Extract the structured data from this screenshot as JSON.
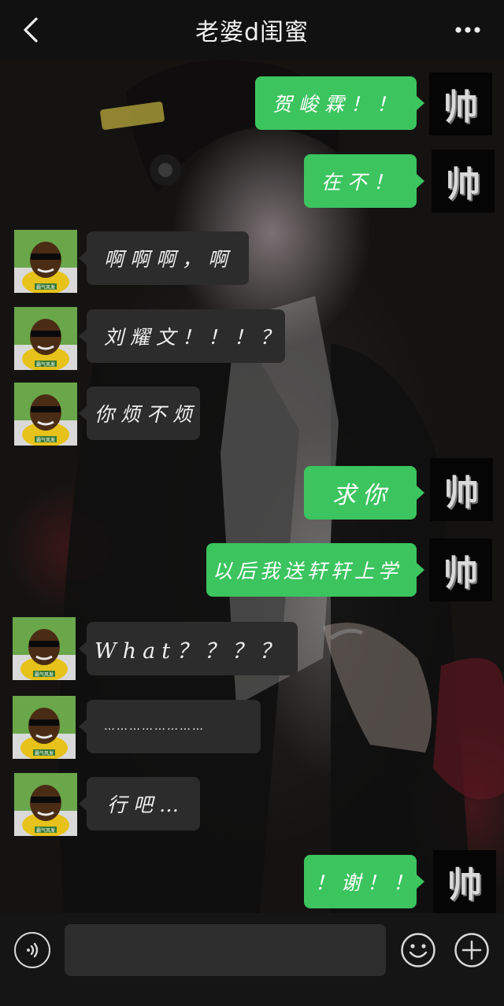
{
  "header": {
    "title": "老婆d闺蜜"
  },
  "messages": [
    {
      "side": "me",
      "text": "贺峻霖！！"
    },
    {
      "side": "me",
      "text": "在不！"
    },
    {
      "side": "other",
      "text": "啊啊啊，啊"
    },
    {
      "side": "other",
      "text": "刘耀文！！！？"
    },
    {
      "side": "other",
      "text": "你烦不烦"
    },
    {
      "side": "me",
      "text": "求你"
    },
    {
      "side": "me",
      "text": "以后我送轩轩上学"
    },
    {
      "side": "other",
      "text": "What？？？？"
    },
    {
      "side": "other",
      "text": "……………………"
    },
    {
      "side": "other",
      "text": "行吧…"
    },
    {
      "side": "me",
      "text": "！谢！！"
    }
  ],
  "avatars": {
    "me": {
      "glyph": "帅",
      "icon": "shuai-character-avatar"
    },
    "other": {
      "caption": "霸气风发",
      "icon": "cartoon-sunglasses-man-avatar"
    }
  },
  "colors": {
    "me_bubble": "#3cc45f",
    "other_bubble": "#2c2c2c",
    "header_bg": "#111111"
  },
  "icons": {
    "back": "chevron-left-icon",
    "more": "more-dots-icon",
    "voice": "voice-icon",
    "emoji": "emoji-icon",
    "plus": "plus-icon"
  }
}
